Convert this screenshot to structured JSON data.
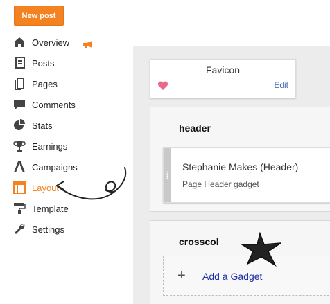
{
  "sidebar": {
    "new_post_label": "New post",
    "items": [
      {
        "label": "Overview",
        "icon": "home-icon"
      },
      {
        "label": "Posts",
        "icon": "posts-icon"
      },
      {
        "label": "Pages",
        "icon": "pages-icon"
      },
      {
        "label": "Comments",
        "icon": "comment-icon"
      },
      {
        "label": "Stats",
        "icon": "pie-chart-icon"
      },
      {
        "label": "Earnings",
        "icon": "trophy-icon"
      },
      {
        "label": "Campaigns",
        "icon": "campaigns-icon"
      },
      {
        "label": "Layout",
        "icon": "layout-icon",
        "active": true
      },
      {
        "label": "Template",
        "icon": "paint-roller-icon"
      },
      {
        "label": "Settings",
        "icon": "wrench-icon"
      }
    ]
  },
  "colors": {
    "accent": "#f58220",
    "link": "#1f2fa8",
    "edit_link": "#4a6fb5",
    "heart": "#e86a8a",
    "canvas": "#ececec"
  },
  "favicon": {
    "title": "Favicon",
    "edit_label": "Edit"
  },
  "header_section": {
    "title": "header",
    "gadget": {
      "title": "Stephanie Makes (Header)",
      "subtitle": "Page Header gadget"
    }
  },
  "crosscol_section": {
    "title": "crosscol",
    "add_gadget_label": "Add a Gadget"
  }
}
